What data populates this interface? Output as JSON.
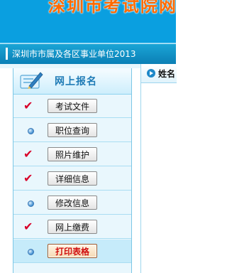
{
  "banner": {
    "title": "深圳市考试院网"
  },
  "subbar": {
    "text": "深圳市市属及各区事业单位2013"
  },
  "sidebar": {
    "title": "网上报名",
    "items": [
      {
        "label": "考试文件",
        "icon": "check-icon"
      },
      {
        "label": "职位查询",
        "icon": "bullet-icon"
      },
      {
        "label": "照片维护",
        "icon": "check-icon"
      },
      {
        "label": "详细信息",
        "icon": "check-icon"
      },
      {
        "label": "修改信息",
        "icon": "bullet-icon"
      },
      {
        "label": "网上缴费",
        "icon": "check-icon"
      },
      {
        "label": "打印表格",
        "icon": "bullet-icon",
        "active": true
      }
    ]
  },
  "main": {
    "label": "姓名"
  },
  "colors": {
    "banner": "#0a9fe0",
    "accent": "#1f7bb6",
    "check": "#d8002a",
    "active_text": "#d01010"
  }
}
